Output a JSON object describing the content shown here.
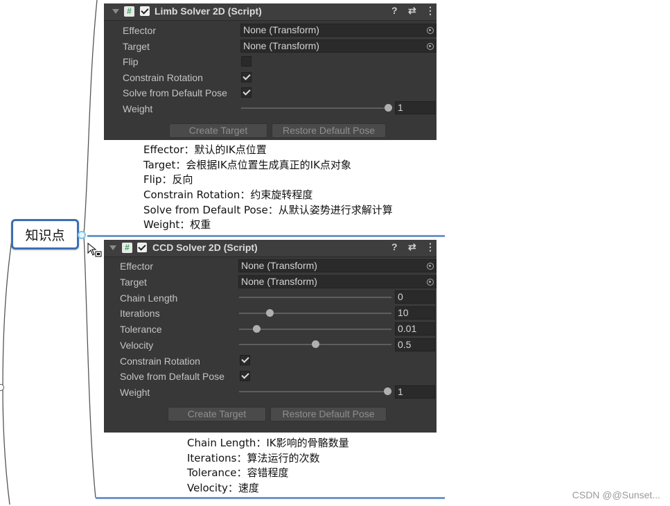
{
  "mindmap": {
    "node_label": "知识点"
  },
  "panel1": {
    "title": "Limb Solver 2D (Script)",
    "rows": {
      "effector_label": "Effector",
      "effector_value": "None (Transform)",
      "target_label": "Target",
      "target_value": "None (Transform)",
      "flip_label": "Flip",
      "flip_checked": false,
      "constrain_label": "Constrain Rotation",
      "constrain_checked": true,
      "solve_label": "Solve from Default Pose",
      "solve_checked": true,
      "weight_label": "Weight",
      "weight_value": "1"
    },
    "buttons": {
      "create": "Create Target",
      "restore": "Restore Default Pose"
    }
  },
  "notes1": [
    "Effector：默认的IK点位置",
    "Target：会根据IK点位置生成真正的IK点对象",
    "Flip：反向",
    "Constrain Rotation：约束旋转程度",
    "Solve from Default Pose：从默认姿势进行求解计算",
    "Weight：权重"
  ],
  "panel2": {
    "title": "CCD Solver 2D (Script)",
    "rows": {
      "effector_label": "Effector",
      "effector_value": "None (Transform)",
      "target_label": "Target",
      "target_value": "None (Transform)",
      "chain_label": "Chain Length",
      "chain_value": "0",
      "iterations_label": "Iterations",
      "iterations_value": "10",
      "tolerance_label": "Tolerance",
      "tolerance_value": "0.01",
      "velocity_label": "Velocity",
      "velocity_value": "0.5",
      "constrain_label": "Constrain Rotation",
      "constrain_checked": true,
      "solve_label": "Solve from Default Pose",
      "solve_checked": true,
      "weight_label": "Weight",
      "weight_value": "1"
    },
    "buttons": {
      "create": "Create Target",
      "restore": "Restore Default Pose"
    }
  },
  "notes2": [
    "Chain Length：IK影响的骨骼数量",
    "Iterations：算法运行的次数",
    "Tolerance：容错程度",
    "Velocity：速度"
  ],
  "watermark": "CSDN @@Sunset...",
  "colors": {
    "panel_bg": "#383838",
    "node_border": "#3b6fb6",
    "divider": "#6d95c9"
  }
}
